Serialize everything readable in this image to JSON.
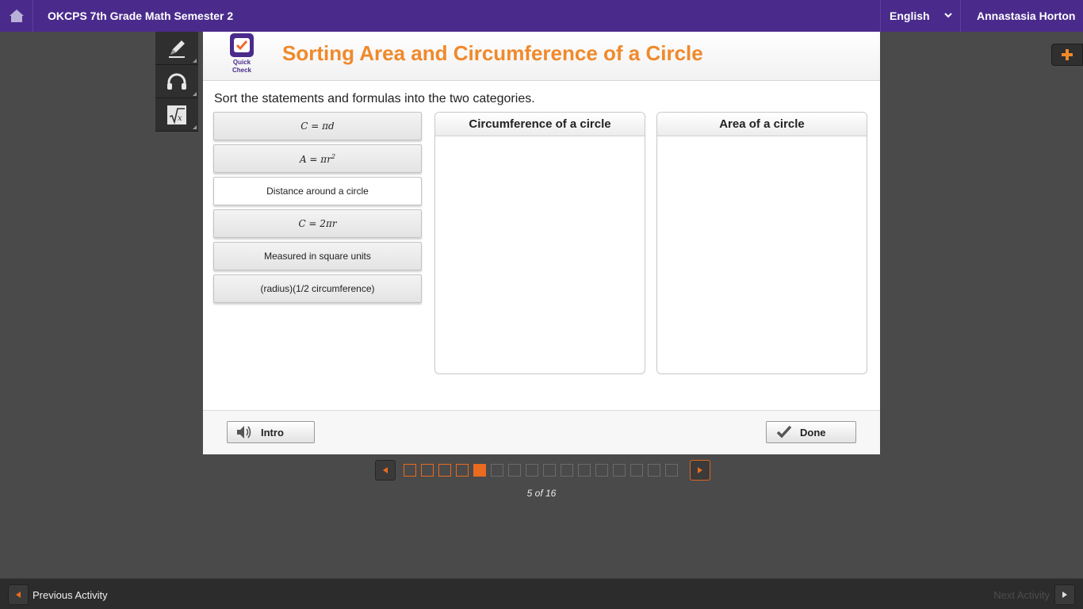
{
  "topbar": {
    "course_title": "OKCPS 7th Grade Math Semester 2",
    "language": "English",
    "user_name": "Annastasia Horton"
  },
  "tools": [
    "pencil-icon",
    "headphones-icon",
    "square-root-icon"
  ],
  "header": {
    "badge_line1": "Quick",
    "badge_line2": "Check",
    "title": "Sorting Area and Circumference of a Circle"
  },
  "instructions": "Sort the statements and formulas into the two categories.",
  "cards": [
    {
      "label": "C = πd"
    },
    {
      "label": "A = πr",
      "superscript": "2"
    },
    {
      "label": "Distance around a circle"
    },
    {
      "label": "C = 2πr"
    },
    {
      "label": "Measured in square units"
    },
    {
      "label": "(radius)(1/2 circumference)"
    }
  ],
  "bins": {
    "circumference": "Circumference of a circle",
    "area": "Area of a circle"
  },
  "footer": {
    "intro_label": "Intro",
    "done_label": "Done"
  },
  "pager": {
    "current": 5,
    "total": 16,
    "label": "5 of 16"
  },
  "bottombar": {
    "previous_label": "Previous Activity",
    "next_label": "Next Activity"
  },
  "colors": {
    "brand_purple": "#4a2b8c",
    "accent_orange": "#f0892b",
    "pager_orange": "#ea6a1f"
  }
}
